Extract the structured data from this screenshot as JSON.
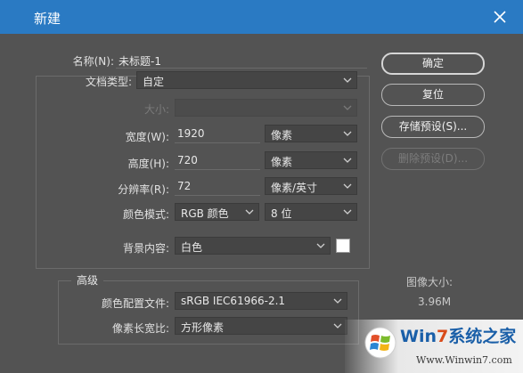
{
  "window": {
    "title": "新建"
  },
  "form": {
    "name_label": "名称(N):",
    "name_value": "未标题-1",
    "doc_type_label": "文档类型:",
    "doc_type_value": "自定",
    "size_label": "大小:",
    "size_value": "",
    "width_label": "宽度(W):",
    "width_value": "1920",
    "width_unit": "像素",
    "height_label": "高度(H):",
    "height_value": "720",
    "height_unit": "像素",
    "resolution_label": "分辨率(R):",
    "resolution_value": "72",
    "resolution_unit": "像素/英寸",
    "color_mode_label": "颜色模式:",
    "color_mode_value": "RGB 颜色",
    "bit_depth_value": "8 位",
    "background_label": "背景内容:",
    "background_value": "白色",
    "background_swatch_color": "#ffffff"
  },
  "advanced": {
    "title": "高级",
    "color_profile_label": "颜色配置文件:",
    "color_profile_value": "sRGB IEC61966-2.1",
    "pixel_aspect_label": "像素长宽比:",
    "pixel_aspect_value": "方形像素"
  },
  "buttons": {
    "ok": "确定",
    "reset": "复位",
    "save_preset": "存储预设(S)...",
    "delete_preset": "删除预设(D)..."
  },
  "image_size": {
    "label": "图像大小:",
    "value": "3.96M"
  },
  "watermark": {
    "brand_prefix": "Win",
    "brand_seven": "7",
    "brand_suffix": "系统之家",
    "url": "Www.Winwin7.com"
  },
  "colors": {
    "titlebar": "#2a7ac3",
    "dialog_bg": "#535353"
  }
}
